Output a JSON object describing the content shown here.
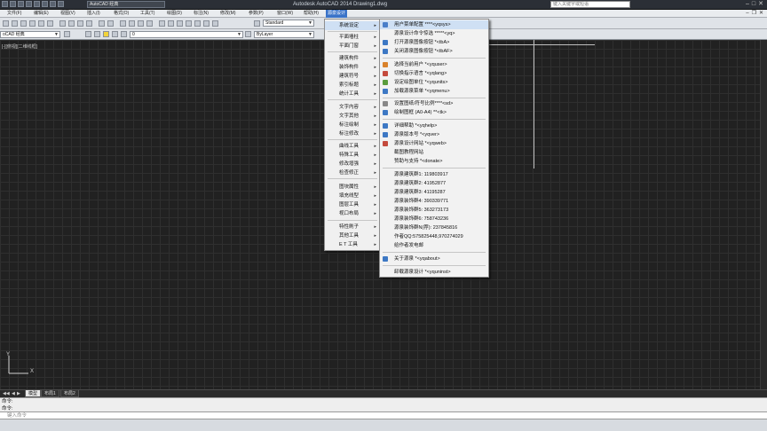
{
  "titlebar": {
    "workspace": "AutoCAD 经典",
    "window_title": "Autodesk AutoCAD 2014    Drawing1.dwg",
    "search_placeholder": "键入关键字或短语"
  },
  "menubar": {
    "items": [
      "文件(F)",
      "编辑(E)",
      "视图(V)",
      "插入(I)",
      "格式(O)",
      "工具(T)",
      "绘图(D)",
      "标注(N)",
      "修改(M)",
      "参数(P)",
      "窗口(W)",
      "帮助(H)",
      "源泉设计"
    ]
  },
  "toolbar": {
    "text_style": "Standard",
    "workspace": "oCAD 经典",
    "layer": "0",
    "color": "ByLayer"
  },
  "canvas": {
    "view_label": "[-][俯视][二维线框]",
    "ucs_x": "X",
    "ucs_y": "Y"
  },
  "menu_main": {
    "items": [
      "系统设定",
      "平面墙柱",
      "平面门窗",
      "建筑构件",
      "装饰构件",
      "建筑符号",
      "索引标题",
      "统计工具",
      "文字内容",
      "文字其他",
      "标注绘制",
      "标注修改",
      "曲线工具",
      "特殊工具",
      "修改增强",
      "检查修正",
      "图块属性",
      "填充线型",
      "图层工具",
      "视口布局",
      "特性刷子",
      "其他工具",
      "E T 工具"
    ]
  },
  "menu_sub": {
    "items": [
      {
        "label": "用户菜单配置      ****<yqsys>",
        "icon_color": "#4a7fc9"
      },
      {
        "label": "源泉设计命令惊选 *****<yq>",
        "icon_color": ""
      },
      {
        "label": "打开源泉图像按钮     *<tbA>",
        "icon_color": "#3d78c4"
      },
      {
        "label": "关闭源泉图像按钮     *<tbAF>",
        "icon_color": "#3d78c4"
      },
      {
        "label": "选择当前用户      *<yquser>",
        "icon_color": "#d9822b"
      },
      {
        "label": "切换指示语言      *<yqlang>",
        "icon_color": "#c44a3d"
      },
      {
        "label": "设定绘图单位      *<yqunits>",
        "icon_color": "#5a9c3d"
      },
      {
        "label": "加载源泉菜单      *<yqmenu>",
        "icon_color": "#3d78c4"
      },
      {
        "label": "设置图纸/符号比例****<sd>",
        "icon_color": "#888888"
      },
      {
        "label": "绘制图框 (A0-A4)     **<tk>",
        "icon_color": "#3d78c4"
      },
      {
        "label": "详细帮助          *<yqhelp>",
        "icon_color": "#3d78c4"
      },
      {
        "label": "源泉版本号        *<yqver>",
        "icon_color": "#3d78c4"
      },
      {
        "label": "源泉设计网站      *<yqweb>",
        "icon_color": "#c44a3d"
      },
      {
        "label": "截图教程网站",
        "icon_color": ""
      },
      {
        "label": "赞助与支持        *<donate>",
        "icon_color": ""
      },
      {
        "label": "源泉建筑群1:      119803917",
        "icon_color": ""
      },
      {
        "label": "源泉建筑群2:      41952877",
        "icon_color": ""
      },
      {
        "label": "源泉建筑群3:      41195287",
        "icon_color": ""
      },
      {
        "label": "源泉装饰群4:      390339771",
        "icon_color": ""
      },
      {
        "label": "源泉装饰群5:      363273173",
        "icon_color": ""
      },
      {
        "label": "源泉装饰群6:      758743236",
        "icon_color": ""
      },
      {
        "label": "源泉装饰群N(荐): 237845816",
        "icon_color": ""
      },
      {
        "label": "作者QQ:575825448,970274029",
        "icon_color": ""
      },
      {
        "label": "给作者发电邮",
        "icon_color": ""
      },
      {
        "label": "关于源泉          *<yqabout>",
        "icon_color": "#3d78c4"
      },
      {
        "label": "卸载源泉设计      *<yquninst>",
        "icon_color": ""
      }
    ]
  },
  "tabs": {
    "items": [
      "模型",
      "布局1",
      "布局2"
    ]
  },
  "command": {
    "history_1": "命令:",
    "history_2": "命令:",
    "placeholder": "键入命令"
  }
}
